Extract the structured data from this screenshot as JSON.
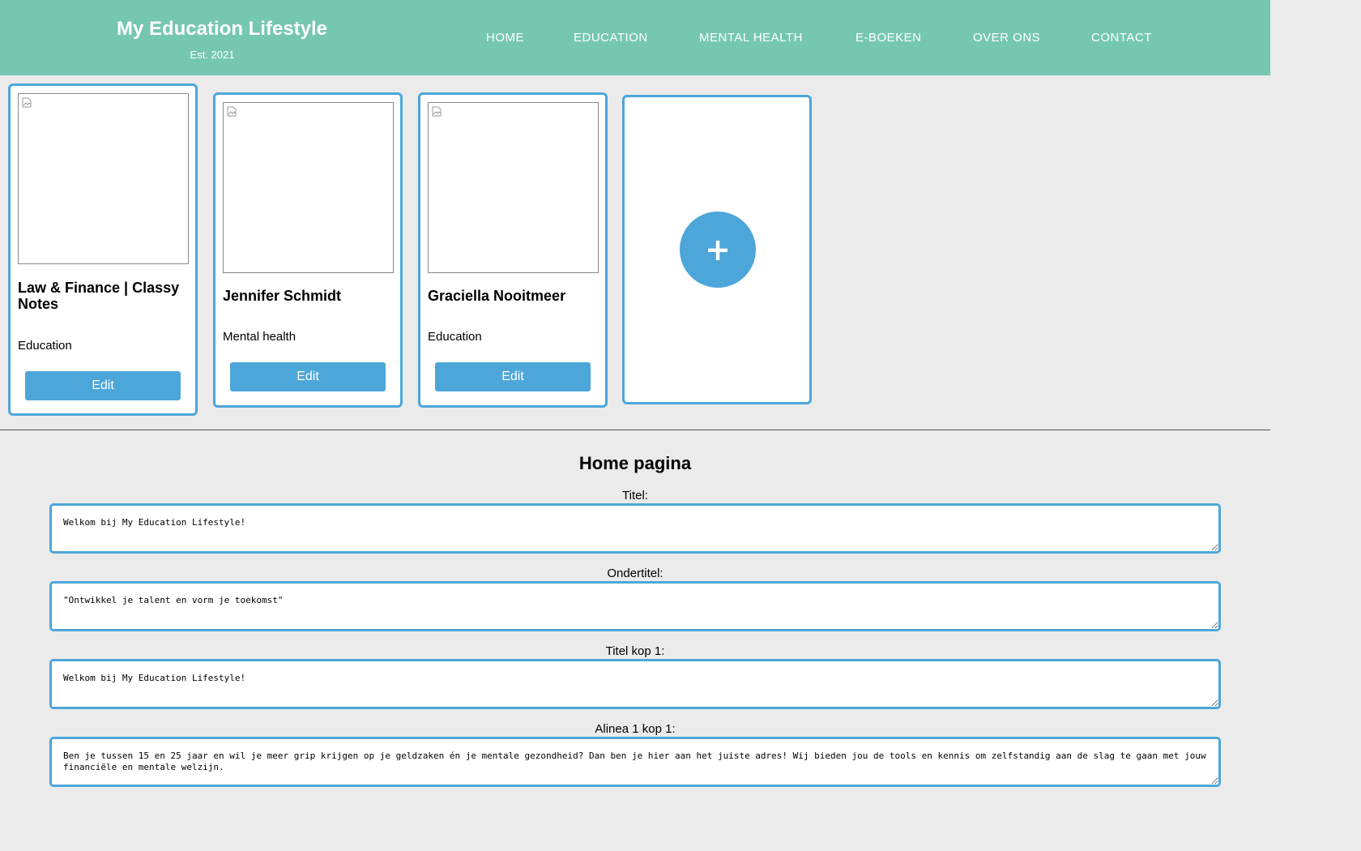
{
  "header": {
    "brand_title": "My Education Lifestyle",
    "brand_subtitle": "Est. 2021",
    "nav": [
      "HOME",
      "EDUCATION",
      "MENTAL HEALTH",
      "E-BOEKEN",
      "OVER ONS",
      "CONTACT"
    ]
  },
  "cards": [
    {
      "name": "Law & Finance | Classy Notes",
      "category": "Education",
      "button": "Edit"
    },
    {
      "name": "Jennifer Schmidt",
      "category": "Mental health",
      "button": "Edit"
    },
    {
      "name": "Graciella Nooitmeer",
      "category": "Education",
      "button": "Edit"
    }
  ],
  "add_card": {
    "symbol": "+"
  },
  "form": {
    "title": "Home pagina",
    "fields": [
      {
        "label": "Titel:",
        "value": "Welkom bij My Education Lifestyle!"
      },
      {
        "label": "Ondertitel:",
        "value": "\"Ontwikkel je talent en vorm je toekomst\""
      },
      {
        "label": "Titel kop 1:",
        "value": "Welkom bij My Education Lifestyle!"
      },
      {
        "label": "Alinea 1 kop 1:",
        "value": "Ben je tussen 15 en 25 jaar en wil je meer grip krijgen op je geldzaken én je mentale gezondheid? Dan ben je hier aan het juiste adres! Wij bieden jou de tools en kennis om zelfstandig aan de slag te gaan met jouw financiële en mentale welzijn."
      }
    ]
  },
  "colors": {
    "header_bg": "#76c7b0",
    "accent": "#4da6d9",
    "page_bg": "#ebebeb"
  }
}
